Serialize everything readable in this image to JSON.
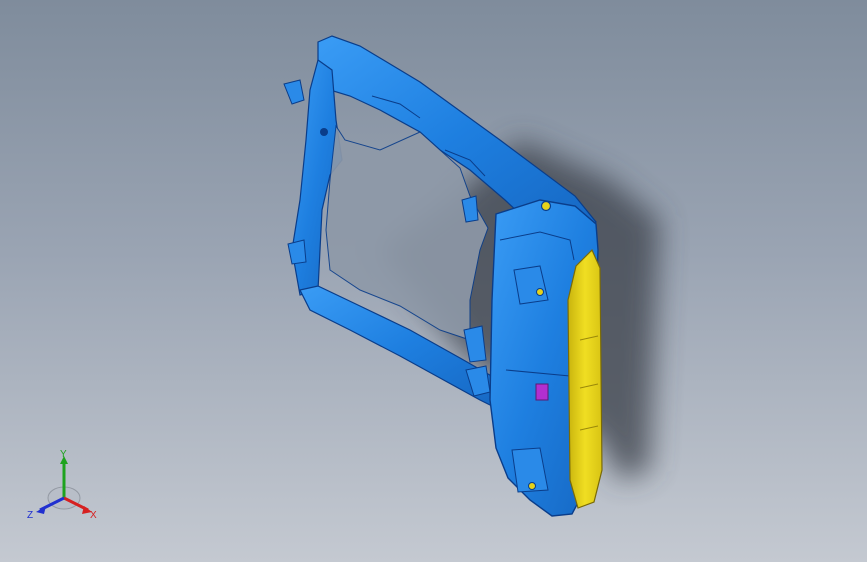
{
  "viewport": {
    "background_top": "#7f8c9c",
    "background_bottom": "#c4c9d1"
  },
  "model": {
    "body_color": "#1e7fe0",
    "highlight_color": "#5fb0ff",
    "edge_color": "#0a3d8a",
    "face_color": "#e6d21a",
    "tab_color": "#b22fd0",
    "shadow_color": "#3a3f48"
  },
  "triad": {
    "x_label": "X",
    "y_label": "Y",
    "z_label": "Z",
    "x_color": "#d62020",
    "y_color": "#1ea31e",
    "z_color": "#2030d0"
  }
}
